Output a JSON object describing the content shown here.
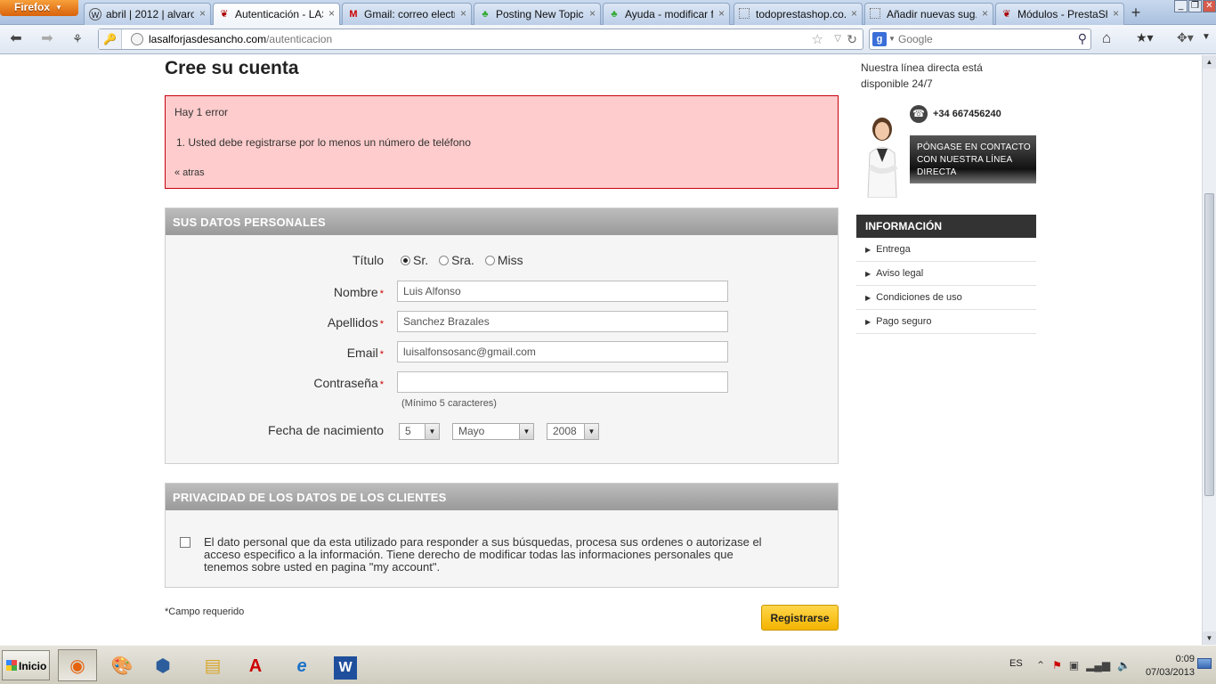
{
  "browser": {
    "menu_button": "Firefox",
    "tabs": [
      {
        "title": "abril | 2012 | alvaro...",
        "icon": "wordpress-icon",
        "active": false
      },
      {
        "title": "Autenticación - LAS...",
        "icon": "prestashop-icon",
        "active": true
      },
      {
        "title": "Gmail: correo electr...",
        "icon": "gmail-icon",
        "active": false
      },
      {
        "title": "Posting New Topic -...",
        "icon": "forum-icon",
        "active": false
      },
      {
        "title": "Ayuda - modificar f...",
        "icon": "forum-icon",
        "active": false
      },
      {
        "title": "todoprestashop.co...",
        "icon": "blank-page-icon",
        "active": false
      },
      {
        "title": "Añadir nuevas sug...",
        "icon": "blank-page-icon",
        "active": false
      },
      {
        "title": "Módulos - PrestaSh...",
        "icon": "prestashop-icon",
        "active": false
      }
    ],
    "url_domain": "lasalforjasdesancho.com",
    "url_path": "/autenticacion",
    "search_placeholder": "Google",
    "search_engine": "g"
  },
  "page": {
    "title": "Cree su cuenta",
    "error": {
      "heading": "Hay 1 error",
      "item": "1.  Usted debe registrarse por lo menos un número de teléfono",
      "back_link": "« atras"
    },
    "personal": {
      "heading": "SUS DATOS PERSONALES",
      "title_label": "Título",
      "title_options": [
        "Sr.",
        "Sra.",
        "Miss"
      ],
      "title_selected": "Sr.",
      "first_name_label": "Nombre",
      "first_name_value": "Luis Alfonso",
      "last_name_label": "Apellidos",
      "last_name_value": "Sanchez Brazales",
      "email_label": "Email",
      "email_value": "luisalfonsosanc@gmail.com",
      "password_label": "Contraseña",
      "password_value": "",
      "password_hint": "(Mínimo 5 caracteres)",
      "birthdate_label": "Fecha de nacimiento",
      "birth_day": "5",
      "birth_month": "Mayo",
      "birth_year": "2008",
      "required_mark": "*"
    },
    "privacy": {
      "heading": "PRIVACIDAD DE LOS DATOS DE LOS CLIENTES",
      "checked": false,
      "text": "El dato personal que da esta utilizado para responder a sus búsquedas, procesa sus ordenes o autorizase el acceso especifico a la información. Tiene derecho de modificar todas las informaciones personales que tenemos sobre usted en pagina \"my account\"."
    },
    "required_note": "*Campo requerido",
    "register_button": "Registrarse"
  },
  "sidebar": {
    "hotline": "Nuestra línea directa está disponible 24/7",
    "phone": "+34 667456240",
    "contact_button": "Póngase en contacto con nuestra línea directa",
    "info_heading": "INFORMACIÓN",
    "info_items": [
      "Entrega",
      "Aviso legal",
      "Condiciones de uso",
      "Pago seguro"
    ]
  },
  "taskbar": {
    "start": "Inicio",
    "language": "ES",
    "time": "0:09",
    "date": "07/03/2013",
    "apps": [
      "firefox-icon",
      "paint-icon",
      "virtualbox-icon",
      "explorer-folder-icon",
      "acrobat-icon",
      "internet-explorer-icon",
      "word-icon"
    ]
  }
}
